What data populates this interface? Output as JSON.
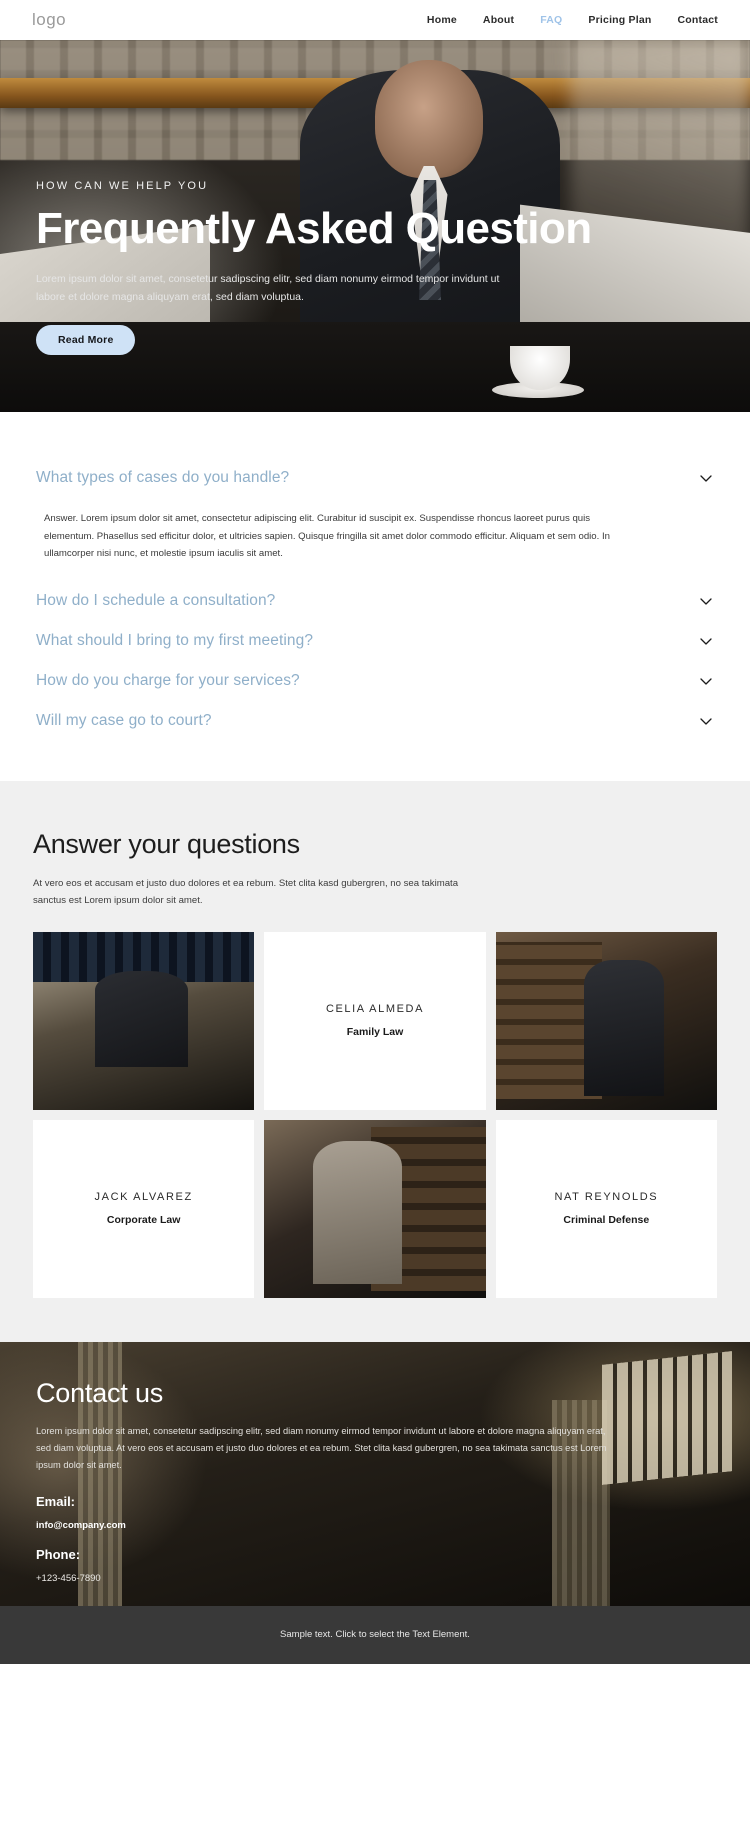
{
  "header": {
    "logo": "logo",
    "nav": [
      {
        "label": "Home",
        "active": false
      },
      {
        "label": "About",
        "active": false
      },
      {
        "label": "FAQ",
        "active": true
      },
      {
        "label": "Pricing Plan",
        "active": false
      },
      {
        "label": "Contact",
        "active": false
      }
    ]
  },
  "hero": {
    "eyebrow": "HOW CAN WE HELP YOU",
    "title": "Frequently Asked Question",
    "subtitle": "Lorem ipsum dolor sit amet, consetetur sadipscing elitr, sed diam nonumy eirmod tempor invidunt ut labore et dolore magna aliquyam erat, sed diam voluptua.",
    "button_label": "Read More",
    "button_color": "#cfe2f6"
  },
  "faq": {
    "accent_color": "#8fafc9",
    "items": [
      {
        "question": "What types of cases do you handle?",
        "expanded": true,
        "answer": "Answer. Lorem ipsum dolor sit amet, consectetur adipiscing elit. Curabitur id suscipit ex. Suspendisse rhoncus laoreet purus quis elementum. Phasellus sed efficitur dolor, et ultricies sapien. Quisque fringilla sit amet dolor commodo efficitur. Aliquam et sem odio. In ullamcorper nisi nunc, et molestie ipsum iaculis sit amet."
      },
      {
        "question": "How do I schedule a consultation?",
        "expanded": false,
        "answer": ""
      },
      {
        "question": "What should I bring to my first meeting?",
        "expanded": false,
        "answer": ""
      },
      {
        "question": "How do you charge for your services?",
        "expanded": false,
        "answer": ""
      },
      {
        "question": "Will my case go to court?",
        "expanded": false,
        "answer": ""
      }
    ]
  },
  "team": {
    "title": "Answer your questions",
    "subtitle": "At vero eos et accusam et justo duo dolores et ea rebum. Stet clita kasd gubergren, no sea takimata sanctus est Lorem ipsum dolor sit amet.",
    "cells": [
      {
        "type": "photo",
        "photo": "man-at-laptop",
        "name": "",
        "role": ""
      },
      {
        "type": "text",
        "photo": "",
        "name": "CELIA ALMEDA",
        "role": "Family Law"
      },
      {
        "type": "photo",
        "photo": "woman-in-library",
        "name": "",
        "role": ""
      },
      {
        "type": "text",
        "photo": "",
        "name": "JACK ALVAREZ",
        "role": "Corporate Law"
      },
      {
        "type": "photo",
        "photo": "woman-at-desk",
        "name": "",
        "role": ""
      },
      {
        "type": "text",
        "photo": "",
        "name": "NAT REYNOLDS",
        "role": "Criminal Defense"
      }
    ]
  },
  "contact": {
    "title": "Contact us",
    "paragraph": "Lorem ipsum dolor sit amet, consetetur sadipscing elitr, sed diam nonumy eirmod tempor invidunt ut labore et dolore magna aliquyam erat, sed diam voluptua. At vero eos et accusam et justo duo dolores et ea rebum. Stet clita kasd gubergren, no sea takimata sanctus est Lorem ipsum dolor sit amet.",
    "email_label": "Email:",
    "email_value": "info@company.com",
    "phone_label": "Phone:",
    "phone_value": "+123-456-7890"
  },
  "footer": {
    "text": "Sample text. Click to select the Text Element."
  }
}
